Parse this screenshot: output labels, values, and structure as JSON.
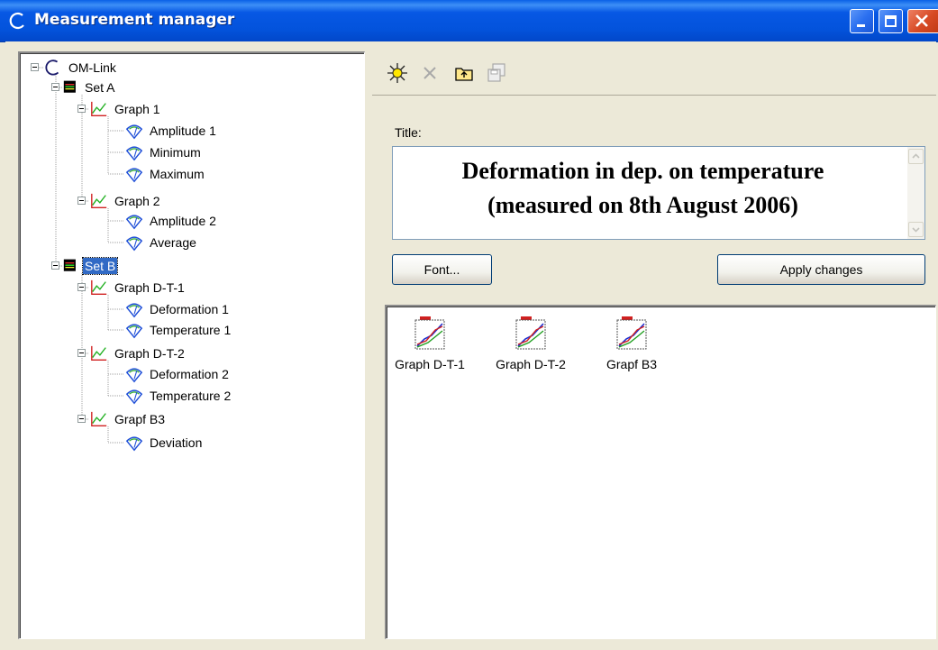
{
  "window": {
    "title": "Measurement manager",
    "controls": [
      "minimize",
      "maximize",
      "close"
    ]
  },
  "tree": {
    "root": {
      "label": "OM-Link",
      "icon": "om-link-icon"
    },
    "sets": [
      {
        "label": "Set A",
        "icon": "set-icon",
        "selected": false,
        "graphs": [
          {
            "label": "Graph 1",
            "icon": "graph-icon",
            "channels": [
              "Amplitude 1",
              "Minimum",
              "Maximum"
            ]
          },
          {
            "label": "Graph 2",
            "icon": "graph-icon",
            "channels": [
              "Amplitude 2",
              "Average"
            ]
          }
        ]
      },
      {
        "label": "Set B",
        "icon": "set-icon",
        "selected": true,
        "graphs": [
          {
            "label": "Graph D-T-1",
            "icon": "graph-icon",
            "channels": [
              "Deformation 1",
              "Temperature 1"
            ]
          },
          {
            "label": "Graph D-T-2",
            "icon": "graph-icon",
            "channels": [
              "Deformation 2",
              "Temperature 2"
            ]
          },
          {
            "label": "Grapf B3",
            "icon": "graph-icon",
            "channels": [
              "Deviation"
            ]
          }
        ]
      }
    ]
  },
  "toolbar": {
    "buttons": [
      {
        "name": "new-icon",
        "enabled": true
      },
      {
        "name": "delete-icon",
        "enabled": false
      },
      {
        "name": "up-folder-icon",
        "enabled": true
      },
      {
        "name": "save-icon",
        "enabled": false
      }
    ]
  },
  "editor": {
    "title_label": "Title:",
    "title_line1": "Deformation in dep. on temperature",
    "title_line2": "(measured on 8th August 2006)",
    "font_button": "Font...",
    "apply_button": "Apply changes"
  },
  "graphs_view": {
    "items": [
      "Graph D-T-1",
      "Graph D-T-2",
      "Grapf B3"
    ]
  },
  "colors": {
    "titlebar": "#0353dc",
    "selection": "#316ac5",
    "face": "#ece9d8",
    "graph_icon_line": "#e02020"
  }
}
